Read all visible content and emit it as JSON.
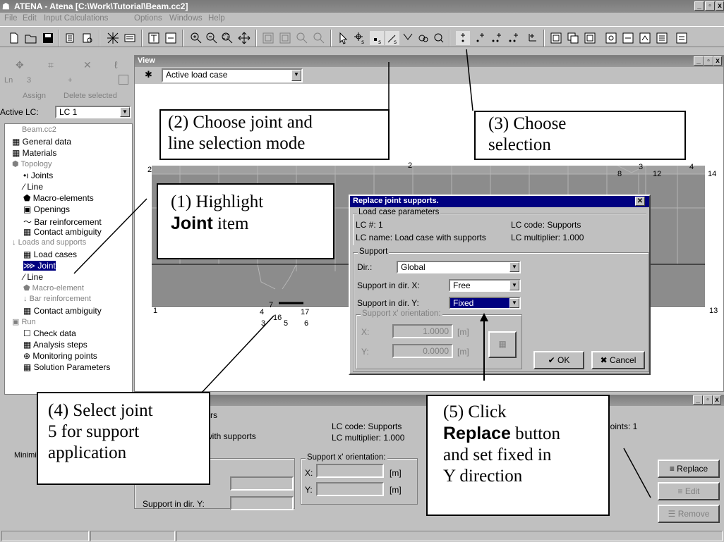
{
  "app": {
    "title": "ATENA - Atena [C:\\Work\\Tutorial\\Beam.cc2]",
    "menu": [
      "File",
      "Edit",
      "Input Calculations",
      "Options",
      "Windows",
      "Help"
    ],
    "window_controls": [
      "_",
      "▫",
      "x"
    ]
  },
  "left_panel": {
    "tool_row1": [
      "✥",
      "⌗",
      "✕",
      "ℓ"
    ],
    "tool_row2": [
      "Ln",
      "3",
      "+"
    ],
    "assign": "Assign",
    "delete_selected": "Delete selected",
    "active_lc_label": "Active LC:",
    "active_lc_value": "LC 1",
    "tree": {
      "root": "Beam.cc2",
      "general_data": "General data",
      "materials": "Materials",
      "topology": "Topology",
      "joints": "Joints",
      "line": "Line",
      "macro_elements": "Macro-elements",
      "openings": "Openings",
      "bar_reinforcement": "Bar reinforcement",
      "contact_ambiguity": "Contact ambiguity",
      "loads_and_supports": "Loads and supports",
      "load_cases": "Load cases",
      "joint": "Joint",
      "line2": "Line",
      "macro_element": "Macro-element",
      "bar_reinforcement2": "Bar reinforcement",
      "contact_ambiguity2": "Contact ambiguity",
      "run": "Run",
      "check_data": "Check data",
      "analysis_steps": "Analysis steps",
      "monitoring_points": "Monitoring points",
      "solution_parameters": "Solution Parameters"
    }
  },
  "view": {
    "title": "View",
    "dropdown_value": "Active load case",
    "joint_labels": [
      "2",
      "2",
      "8",
      "3",
      "12",
      "4",
      "14",
      "1",
      "7",
      "16",
      "4",
      "17",
      "3",
      "5",
      "6",
      "13"
    ]
  },
  "dialog": {
    "title": "Replace joint supports.",
    "lc_group": "Load case parameters",
    "lc_num": "LC #: 1",
    "lc_code": "LC code: Supports",
    "lc_name": "LC name: Load case with supports",
    "lc_multiplier": "LC multiplier: 1.000",
    "support_group": "Support",
    "dir_label": "Dir.:",
    "dir_value": "Global",
    "support_x_label": "Support in dir. X:",
    "support_x_value": "Free",
    "support_y_label": "Support in dir. Y:",
    "support_y_value": "Fixed",
    "orientation_group": "Support x' orientation:",
    "x_label": "X:",
    "x_value": "1.0000",
    "y_label": "Y:",
    "y_value": "0.0000",
    "unit": "[m]",
    "ok": "OK",
    "cancel": "Cancel"
  },
  "bottom_panel": {
    "params_title": "ters",
    "lc_name_tail": "se with supports",
    "lc_code": "LC code: Supports",
    "lc_multiplier": "LC multiplier: 1.000",
    "joints_count": "joints: 1",
    "left_tab": "Minimi",
    "orientation_group": "Support x' orientation:",
    "x_label": "X:",
    "y_label": "Y:",
    "unit": "[m]",
    "support_dir_y": "Support in dir. Y:",
    "replace": "Replace",
    "edit": "Edit",
    "remove": "Remove"
  },
  "callouts": {
    "c1_pre": "(1) Highlight",
    "c1_bold": "Joint",
    "c1_post": " item",
    "c2_line1": "(2) Choose joint and",
    "c2_line2": "line selection mode",
    "c3_line1": "(3) Choose",
    "c3_line2": "selection",
    "c4_line1": "(4) Select joint",
    "c4_line2": "5 for support",
    "c4_line3": "application",
    "c5_line1": "(5) Click",
    "c5_bold": "Replace",
    "c5_line2_post": " button",
    "c5_line3": "and set fixed in",
    "c5_line4": "Y direction"
  }
}
